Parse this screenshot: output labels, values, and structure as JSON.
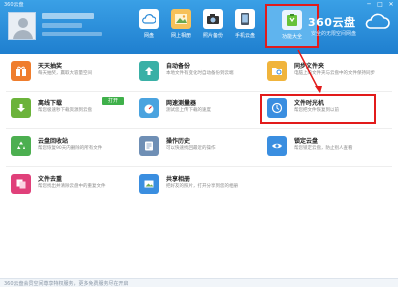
{
  "window": {
    "title": "360云盘",
    "controls": [
      "─",
      "□",
      "✕"
    ]
  },
  "nav": {
    "items": [
      {
        "label": "网盘",
        "icon": "cloud-disk-icon",
        "color": "#2c8bd8"
      },
      {
        "label": "网上相册",
        "icon": "photo-album-icon",
        "color": "#f2a33a"
      },
      {
        "label": "照片备份",
        "icon": "camera-icon",
        "color": "#333333"
      },
      {
        "label": "手机云盘",
        "icon": "phone-icon",
        "color": "#4a5868"
      },
      {
        "label": "功能大全",
        "icon": "toolbox-icon",
        "color": "#67c23a",
        "active": true
      }
    ]
  },
  "brand": {
    "name": "360云盘",
    "slogan": "安全的无限空间网盘"
  },
  "cards": [
    {
      "title": "天天抽奖",
      "desc": "每天抽奖，赢取大容量空间",
      "icon": "gift-icon",
      "color": "#ef7d2d"
    },
    {
      "title": "自动备份",
      "desc": "本地文件有变化时自动备份到云端",
      "icon": "upload-icon",
      "color": "#3ab0a6"
    },
    {
      "title": "同步文件夹",
      "desc": "电脑上的文件夹与云盘中的文件保持同步",
      "icon": "sync-folder-icon",
      "color": "#f0b43c"
    },
    {
      "title": "离线下载",
      "desc": "帮您极速秒下载资源到云盘",
      "icon": "download-icon",
      "color": "#6bb33a",
      "button": "打开"
    },
    {
      "title": "网速测量器",
      "desc": "测试您上传下载的速度",
      "icon": "speedometer-icon",
      "color": "#4aa3df"
    },
    {
      "title": "文件时光机",
      "desc": "帮您把文件恢复到以前",
      "icon": "time-machine-icon",
      "color": "#3a8ee0"
    },
    {
      "title": "云盘回收站",
      "desc": "帮您恢复90天内删除的所有文件",
      "icon": "recycle-icon",
      "color": "#4caf50"
    },
    {
      "title": "操作历史",
      "desc": "可以快速找回最近的操作",
      "icon": "history-icon",
      "color": "#6f8fb5"
    },
    {
      "title": "锁定云盘",
      "desc": "帮您锁定云盘，防止别人查看",
      "icon": "eye-lock-icon",
      "color": "#3a8ee0"
    },
    {
      "title": "文件去重",
      "desc": "帮您找出并清除云盘中的重复文件",
      "icon": "dedupe-icon",
      "color": "#e0407a"
    },
    {
      "title": "共享相册",
      "desc": "把好友的照片，打开分享到您的相册",
      "icon": "shared-album-icon",
      "color": "#3a8ee0"
    }
  ],
  "footer": {
    "text": "360云盘会员空间尊享特权服务，更多免费服务尽在开启"
  }
}
